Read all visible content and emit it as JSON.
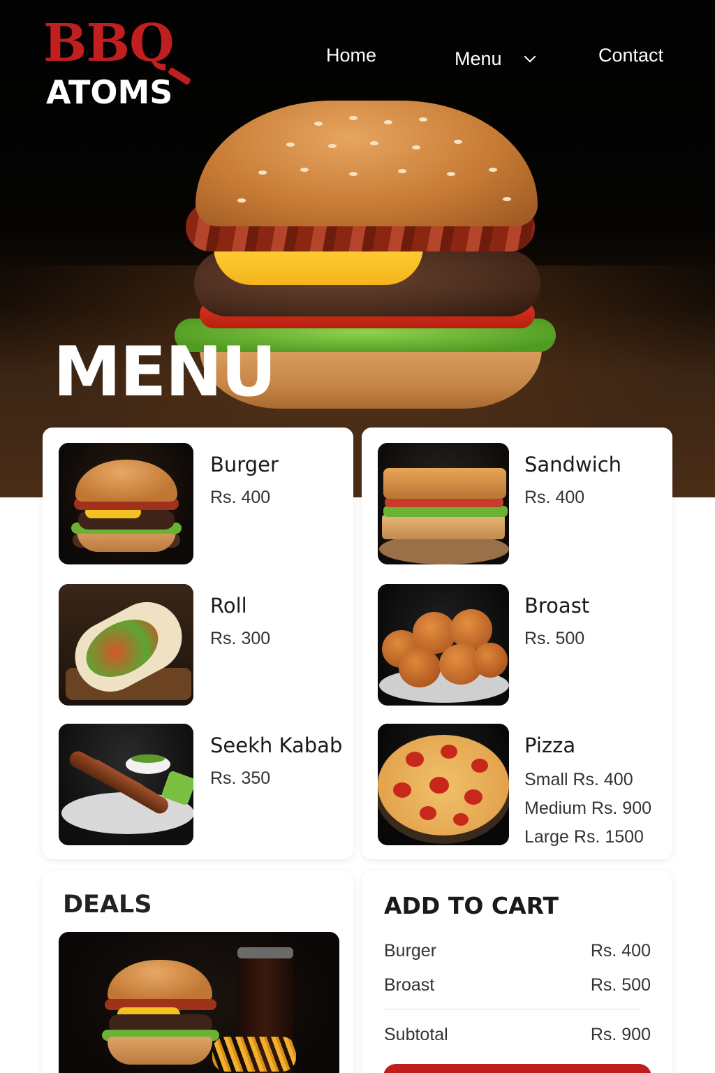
{
  "brand": {
    "line1": "BBQ",
    "line2": "ATOMS",
    "accent_color": "#c11f1f"
  },
  "nav": {
    "home": "Home",
    "menu": "Menu",
    "contact": "Contact",
    "menu_icon": "chevron-down-icon"
  },
  "hero": {
    "title": "MENU"
  },
  "menu": {
    "left": [
      {
        "name": "Burger",
        "price": "Rs. 400"
      },
      {
        "name": "Roll",
        "price": "Rs. 300"
      },
      {
        "name": "Seekh Kabab",
        "price": "Rs. 350"
      }
    ],
    "right": [
      {
        "name": "Sandwich",
        "price": "Rs. 400"
      },
      {
        "name": "Broast",
        "price": "Rs. 500"
      },
      {
        "name": "Pizza",
        "sizes": [
          "Small Rs. 400",
          "Medium Rs. 900",
          "Large Rs. 1500"
        ]
      }
    ]
  },
  "deals": {
    "title": "DEALS"
  },
  "cart": {
    "title": "ADD TO CART",
    "items": [
      {
        "name": "Burger",
        "price": "Rs. 400"
      },
      {
        "name": "Broast",
        "price": "Rs. 500"
      }
    ],
    "subtotal_label": "Subtotal",
    "subtotal_value": "Rs. 900",
    "button_color": "#c21d1d"
  }
}
